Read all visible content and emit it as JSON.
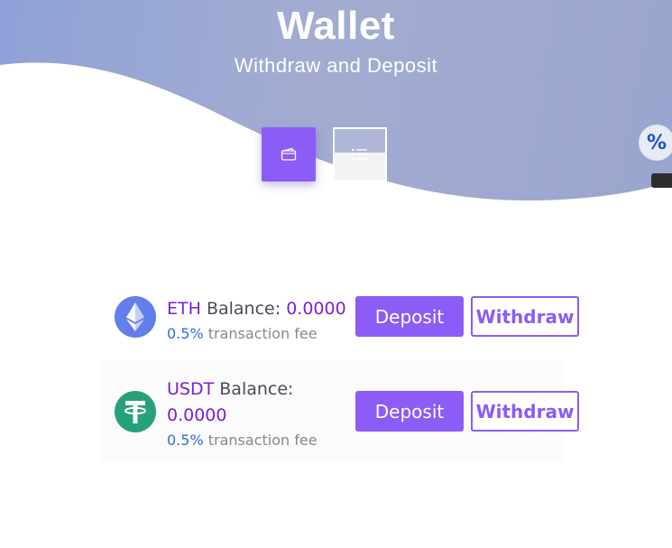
{
  "header": {
    "title": "Wallet",
    "subtitle": "Withdraw and Deposit"
  },
  "tabs": [
    {
      "name": "wallet",
      "icon": "wallet-icon",
      "active": true
    },
    {
      "name": "list",
      "icon": "list-icon",
      "active": false
    }
  ],
  "promo": {
    "symbol": "%"
  },
  "coins": [
    {
      "symbol": "ETH",
      "balance_label": "Balance:",
      "balance": "0.0000",
      "fee_pct": "0.5%",
      "fee_text": "transaction fee",
      "deposit_label": "Deposit",
      "withdraw_label": "Withdraw",
      "icon": "ethereum-icon"
    },
    {
      "symbol": "USDT",
      "balance_label": "Balance:",
      "balance": "0.0000",
      "fee_pct": "0.5%",
      "fee_text": "transaction fee",
      "deposit_label": "Deposit",
      "withdraw_label": "Withdraw",
      "icon": "tether-icon"
    }
  ],
  "colors": {
    "accent": "#8b5cf6",
    "coin_text": "#7b1fd6",
    "fee_pct": "#2f6fd6",
    "eth": "#627eea",
    "usdt": "#26a17b"
  }
}
